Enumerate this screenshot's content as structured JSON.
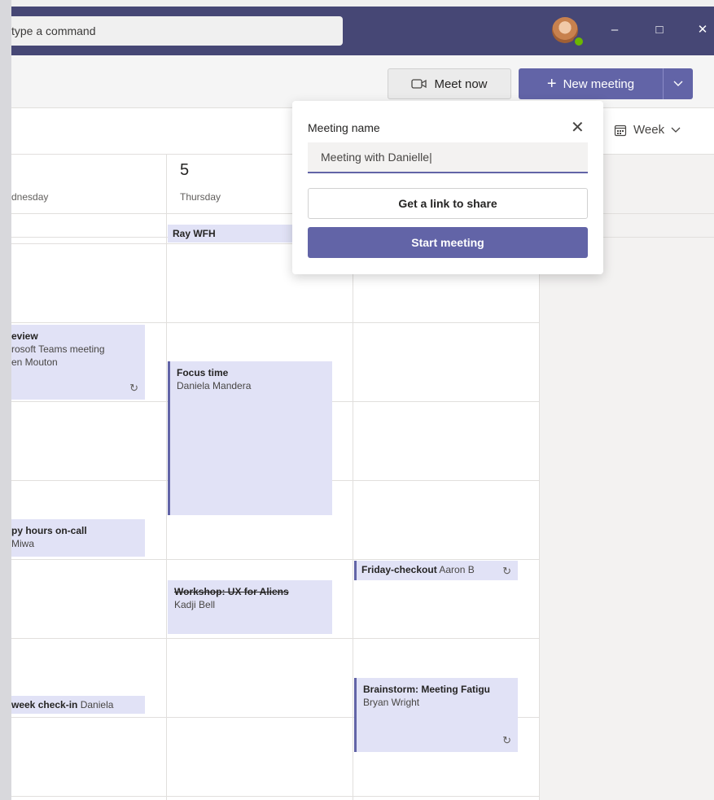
{
  "titlebar": {
    "command_placeholder": "type a command",
    "minimize_glyph": "–",
    "maximize_glyph": "□",
    "close_glyph": "✕"
  },
  "header": {
    "meet_now_label": "Meet now",
    "new_meeting_label": "New meeting"
  },
  "toolbar": {
    "view_label": "Week"
  },
  "days": [
    {
      "number": "",
      "name": "dnesday"
    },
    {
      "number": "5",
      "name": "Thursday"
    }
  ],
  "events": {
    "ray_wfh": {
      "title": "Ray WFH"
    },
    "review": {
      "title": "eview",
      "line1": "rosoft Teams meeting",
      "line2": "en Mouton"
    },
    "focus": {
      "title": "Focus time",
      "line1": "Daniela Mandera"
    },
    "happy": {
      "title": "py hours on-call",
      "line1": "Miwa"
    },
    "checkout": {
      "title": "Friday-checkout",
      "line1": "Aaron B"
    },
    "workshop": {
      "title": "Workshop: UX for Aliens",
      "line1": "Kadji Bell"
    },
    "checkin": {
      "title": "week check-in",
      "line1": "Daniela"
    },
    "brainstorm": {
      "title": "Brainstorm: Meeting Fatigu",
      "line1": "Bryan Wright"
    }
  },
  "popup": {
    "label": "Meeting name",
    "input_value": "Meeting with Danielle|",
    "get_link_label": "Get a link to share",
    "start_label": "Start meeting"
  },
  "colors": {
    "titlebar": "#464775",
    "accent": "#6264a7",
    "event_bg": "#e1e2f6",
    "presence": "#6bb700"
  },
  "icons": [
    "video-camera-icon",
    "plus-icon",
    "chevron-down-icon",
    "calendar-icon",
    "close-icon",
    "recurring-icon",
    "avatar"
  ]
}
